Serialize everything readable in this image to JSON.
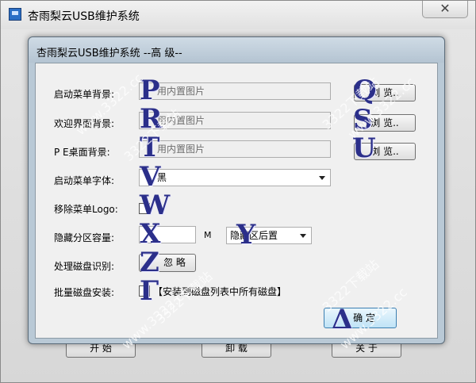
{
  "main_window": {
    "title": "杏雨梨云USB维护系统",
    "close_glyph": "✕",
    "bottom_buttons": [
      "开 始",
      "卸 载",
      "关 于"
    ]
  },
  "dialog": {
    "title": "杏雨梨云USB维护系统 --高 级--",
    "rows": {
      "boot_menu_bg": {
        "label": "启动菜单背景:",
        "value": "用内置图片",
        "browse": "浏 览.."
      },
      "welcome_bg": {
        "label": "欢迎界面背景:",
        "value": "用内置图片",
        "browse": "浏 览.."
      },
      "pe_desktop_bg": {
        "label": "P E桌面背景:",
        "value": "用内置图片",
        "browse": "浏 览.."
      },
      "menu_font": {
        "label": "启动菜单字体:",
        "value": "黑"
      },
      "remove_logo": {
        "label": "移除菜单Logo:"
      },
      "hidden_size": {
        "label": "隐藏分区容量:",
        "unit": "M",
        "position_value": "隐藏区后置"
      },
      "disk_detect": {
        "label": "处理磁盘识别:",
        "button": "忽 略"
      },
      "batch_install": {
        "label": "批量磁盘安装:",
        "option_text": "【安装到磁盘列表中所有磁盘】"
      }
    },
    "ok_button": "确 定"
  },
  "annotations": [
    "P",
    "Q",
    "R",
    "S",
    "T",
    "U",
    "V",
    "W",
    "X",
    "Y",
    "Z",
    "Γ",
    "Δ"
  ],
  "watermark": "www.3322.cc",
  "watermark_alt": "3322下载站",
  "colors": {
    "annotation": "#2b2f8a",
    "dialog_frame": "#b9c9d6",
    "ok_button": "#bfe3f6"
  }
}
